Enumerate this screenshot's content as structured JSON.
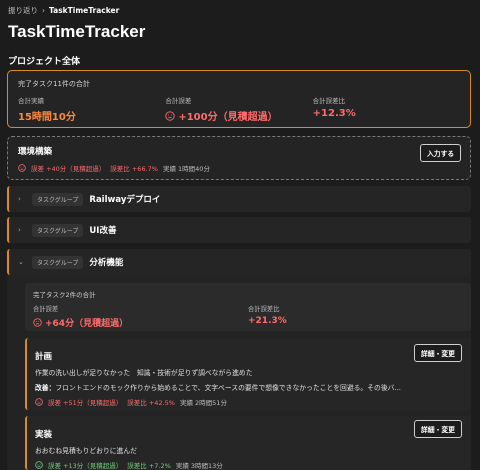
{
  "breadcrumb": {
    "back": "振り返り",
    "sep": "›",
    "current": "TaskTimeTracker"
  },
  "app_title": "TaskTimeTracker",
  "section_title": "プロジェクト全体",
  "summary": {
    "caption": "完了タスク11件の合計",
    "actual_label": "合計実績",
    "actual_value": "15時間10分",
    "error_label": "合計誤差",
    "error_value": "+100分（見積超過）",
    "ratio_label": "合計誤差比",
    "ratio_value": "+12.3%"
  },
  "env": {
    "name": "環境構築",
    "error": "誤差 +40分（見積超過）",
    "ratio": "誤差比 +66.7%",
    "actual": "実績 1時間40分",
    "input_button": "入力する"
  },
  "groups": [
    {
      "tag": "タスクグループ",
      "name": "Railwayデプロイ",
      "chevron": "›"
    },
    {
      "tag": "タスクグループ",
      "name": "UI改善",
      "chevron": "›"
    },
    {
      "tag": "タスクグループ",
      "name": "分析機能",
      "chevron": "⌄"
    }
  ],
  "sub_summary": {
    "caption": "完了タスク2件の合計",
    "error_label": "合計誤差",
    "error_value": "+64分（見積超過）",
    "ratio_label": "合計誤差比",
    "ratio_value": "+21.3%"
  },
  "tasks": [
    {
      "name": "計画",
      "line1": "作業の洗い出しが足りなかった　知識・技術が足りず調べながら進めた",
      "improve_label": "改善：",
      "improve_text": "フロントエンドのモック作りから始めることで、文字ベースの要件で想像できなかったことを回避る。その後バ...",
      "error": "誤差 +51分（見積超過）",
      "ratio": "誤差比 +42.5%",
      "actual": "実績 2時間51分",
      "detail_button": "詳細・変更"
    },
    {
      "name": "実装",
      "line1": "おおむね見積もりどおりに進んだ",
      "error": "誤差 +13分（見積超過）",
      "ratio": "誤差比 +7.2%",
      "actual": "実績 3時間13分",
      "detail_button": "詳細・変更"
    }
  ],
  "colors": {
    "accent": "#d98b2b",
    "over": "#ff6b6b",
    "ok": "#6fd07a"
  }
}
